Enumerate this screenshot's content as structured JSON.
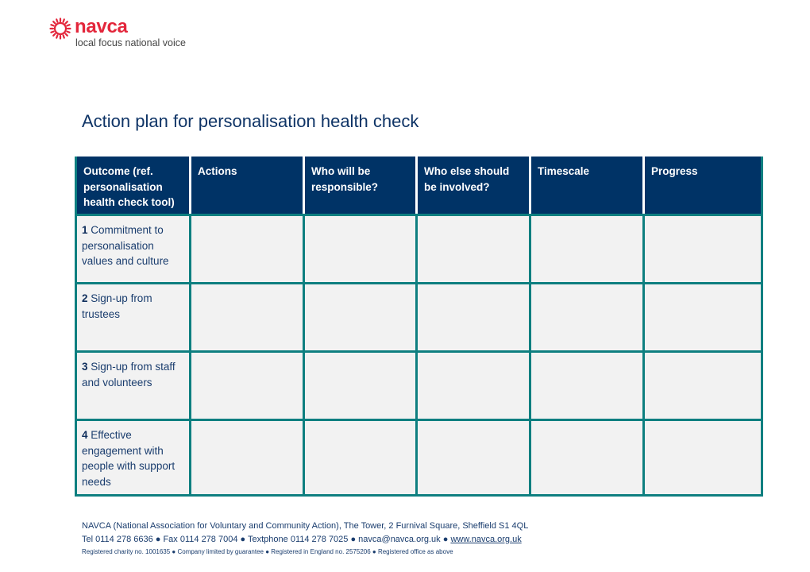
{
  "brand": {
    "logo_icon": "sunburst-icon",
    "name": "navca",
    "tagline": "local focus national voice",
    "colors": {
      "brand_red": "#e3263b",
      "header_navy": "#003366",
      "grid_teal": "#0e7f80",
      "cell_grey": "#f2f2f2",
      "text_navy": "#1a3d6e"
    }
  },
  "page": {
    "title": "Action plan for personalisation health check"
  },
  "table": {
    "headers": [
      "Outcome (ref. personalisation health check tool)",
      "Actions",
      "Who will be responsible?",
      "Who else should be involved?",
      "Timescale",
      "Progress"
    ],
    "rows": [
      {
        "number": "1",
        "outcome": "Commitment to personalisation values and culture",
        "actions": "",
        "responsible": "",
        "involved": "",
        "timescale": "",
        "progress": ""
      },
      {
        "number": "2",
        "outcome": "Sign-up from trustees",
        "actions": "",
        "responsible": "",
        "involved": "",
        "timescale": "",
        "progress": ""
      },
      {
        "number": "3",
        "outcome": "Sign-up from staff and volunteers",
        "actions": "",
        "responsible": "",
        "involved": "",
        "timescale": "",
        "progress": ""
      },
      {
        "number": "4",
        "outcome": "Effective engagement with people with support needs",
        "actions": "",
        "responsible": "",
        "involved": "",
        "timescale": "",
        "progress": ""
      }
    ]
  },
  "footer": {
    "line1": "NAVCA (National Association for Voluntary and Community Action), The Tower, 2 Furnival Square, Sheffield S1 4QL",
    "line2_prefix": "Tel 0114 278 6636 ● Fax 0114 278 7004 ● Textphone 0114 278 7025 ● navca@navca.org.uk ● ",
    "website": "www.navca.org.uk",
    "line3": "Registered charity no. 1001635 ● Company limited by guarantee ● Registered in England no. 2575206 ● Registered office as above"
  }
}
